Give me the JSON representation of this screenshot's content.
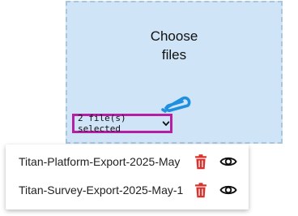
{
  "dropzone": {
    "title_line1": "Choose",
    "title_line2": "files",
    "icon": "paperclip-icon",
    "background_color": "#cfe4f6",
    "border_color": "#a7c6e0"
  },
  "selection": {
    "label": "2 file(s) selected",
    "icon": "chevron-down-icon",
    "highlight_color": "#b51fa3"
  },
  "files": [
    {
      "name": "Titan-Platform-Export-2025-May",
      "delete_icon": "trash-icon",
      "view_icon": "eye-icon"
    },
    {
      "name": "Titan-Survey-Export-2025-May-1",
      "delete_icon": "trash-icon",
      "view_icon": "eye-icon"
    }
  ],
  "colors": {
    "accent": "#1f8fe0",
    "delete": "#d9312b"
  }
}
